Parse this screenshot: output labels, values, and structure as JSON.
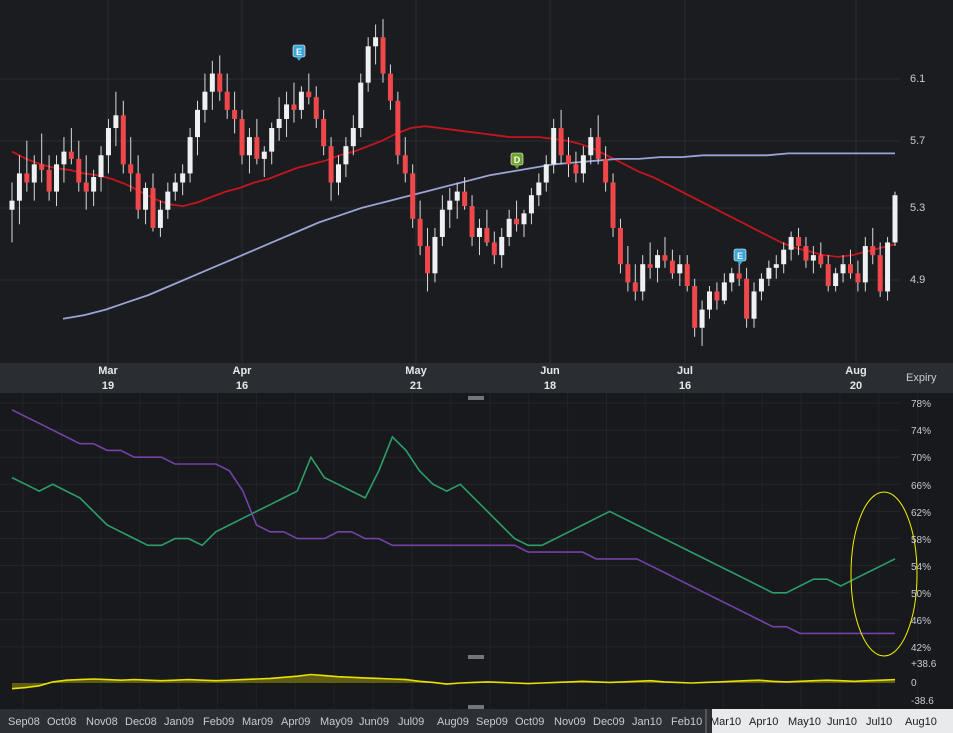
{
  "colors": {
    "background": "#16181b",
    "panel_bg": "#1b1d20",
    "grid": "#2a2d31",
    "candle_up": "#eef0f2",
    "candle_down": "#f0474b",
    "ma_short": "#c5161d",
    "ma_long": "#9aa4d6",
    "hv": "#2e9e68",
    "iv": "#7442a8",
    "spread": "#e8e000",
    "highlight_ellipse": "#f5f000",
    "marker_earnings": "#3aa7d8",
    "marker_dividend": "#6ea12a"
  },
  "price_panel": {
    "y_ticks": [
      "6.1",
      "5.7",
      "5.3",
      "4.9"
    ],
    "month_labels": [
      "Mar",
      "Apr",
      "May",
      "Jun",
      "Jul",
      "Aug"
    ],
    "expiry_days": [
      "19",
      "16",
      "21",
      "18",
      "16",
      "20"
    ],
    "expiry_label": "Expiry",
    "markers": [
      {
        "label": "E",
        "kind": "earnings",
        "date": "Apr 2009"
      },
      {
        "label": "D",
        "kind": "dividend",
        "date": "Jun 2009"
      },
      {
        "label": "E",
        "kind": "earnings",
        "date": "Jul 2009"
      }
    ]
  },
  "vol_panel": {
    "y_ticks": [
      "78%",
      "74%",
      "70%",
      "66%",
      "62%",
      "58%",
      "54%",
      "50%",
      "46%",
      "42%"
    ]
  },
  "spread_panel": {
    "y_ticks": [
      "+38.6",
      "0",
      "-38.6"
    ]
  },
  "x_axis": {
    "labels": [
      "Sep08",
      "Oct08",
      "Nov08",
      "Dec08",
      "Jan09",
      "Feb09",
      "Mar09",
      "Apr09",
      "May09",
      "Jun09",
      "Jul09",
      "Aug09",
      "Sep09",
      "Oct09",
      "Nov09",
      "Dec09",
      "Jan10",
      "Feb10",
      "Mar10",
      "Apr10",
      "May10",
      "Jun10",
      "Jul10",
      "Aug10"
    ],
    "selection_start": "Mar10"
  },
  "chart_data": [
    {
      "type": "candlestick",
      "y_range": [
        4.5,
        6.4
      ],
      "x_range": [
        "Feb 2010",
        "Aug 2010"
      ],
      "candles": [
        [
          5.3,
          5.45,
          5.12,
          5.35
        ],
        [
          5.35,
          5.6,
          5.22,
          5.5
        ],
        [
          5.5,
          5.68,
          5.4,
          5.45
        ],
        [
          5.45,
          5.6,
          5.35,
          5.55
        ],
        [
          5.55,
          5.72,
          5.45,
          5.52
        ],
        [
          5.52,
          5.6,
          5.35,
          5.4
        ],
        [
          5.4,
          5.6,
          5.32,
          5.55
        ],
        [
          5.55,
          5.7,
          5.45,
          5.62
        ],
        [
          5.62,
          5.75,
          5.55,
          5.58
        ],
        [
          5.58,
          5.68,
          5.4,
          5.45
        ],
        [
          5.45,
          5.6,
          5.3,
          5.4
        ],
        [
          5.4,
          5.52,
          5.32,
          5.48
        ],
        [
          5.48,
          5.65,
          5.4,
          5.6
        ],
        [
          5.6,
          5.8,
          5.5,
          5.75
        ],
        [
          5.75,
          5.95,
          5.65,
          5.82
        ],
        [
          5.82,
          5.9,
          5.5,
          5.55
        ],
        [
          5.55,
          5.7,
          5.4,
          5.5
        ],
        [
          5.5,
          5.6,
          5.25,
          5.3
        ],
        [
          5.3,
          5.45,
          5.22,
          5.42
        ],
        [
          5.42,
          5.5,
          5.18,
          5.2
        ],
        [
          5.2,
          5.35,
          5.15,
          5.3
        ],
        [
          5.3,
          5.45,
          5.25,
          5.4
        ],
        [
          5.4,
          5.5,
          5.35,
          5.45
        ],
        [
          5.45,
          5.55,
          5.38,
          5.5
        ],
        [
          5.5,
          5.75,
          5.45,
          5.7
        ],
        [
          5.7,
          5.9,
          5.6,
          5.85
        ],
        [
          5.85,
          6.05,
          5.78,
          5.95
        ],
        [
          5.95,
          6.12,
          5.85,
          6.05
        ],
        [
          6.05,
          6.15,
          5.9,
          5.95
        ],
        [
          5.95,
          6.05,
          5.8,
          5.85
        ],
        [
          5.85,
          5.95,
          5.72,
          5.8
        ],
        [
          5.8,
          5.85,
          5.55,
          5.6
        ],
        [
          5.6,
          5.75,
          5.5,
          5.7
        ],
        [
          5.7,
          5.8,
          5.55,
          5.58
        ],
        [
          5.58,
          5.65,
          5.48,
          5.62
        ],
        [
          5.62,
          5.78,
          5.55,
          5.75
        ],
        [
          5.75,
          5.92,
          5.68,
          5.8
        ],
        [
          5.8,
          5.95,
          5.7,
          5.88
        ],
        [
          5.88,
          6.0,
          5.78,
          5.85
        ],
        [
          5.85,
          5.98,
          5.8,
          5.95
        ],
        [
          5.95,
          6.05,
          5.88,
          5.92
        ],
        [
          5.92,
          5.98,
          5.75,
          5.8
        ],
        [
          5.8,
          5.85,
          5.6,
          5.65
        ],
        [
          5.65,
          5.7,
          5.35,
          5.45
        ],
        [
          5.45,
          5.6,
          5.38,
          5.55
        ],
        [
          5.55,
          5.7,
          5.48,
          5.65
        ],
        [
          5.65,
          5.82,
          5.6,
          5.75
        ],
        [
          5.75,
          6.05,
          5.7,
          6.0
        ],
        [
          6.0,
          6.25,
          5.95,
          6.2
        ],
        [
          6.2,
          6.32,
          6.1,
          6.25
        ],
        [
          6.25,
          6.35,
          6.0,
          6.05
        ],
        [
          6.05,
          6.1,
          5.85,
          5.9
        ],
        [
          5.9,
          5.95,
          5.55,
          5.6
        ],
        [
          5.6,
          5.7,
          5.45,
          5.5
        ],
        [
          5.5,
          5.55,
          5.2,
          5.25
        ],
        [
          5.25,
          5.35,
          5.05,
          5.1
        ],
        [
          5.1,
          5.2,
          4.85,
          4.95
        ],
        [
          4.95,
          5.2,
          4.9,
          5.15
        ],
        [
          5.15,
          5.38,
          5.1,
          5.3
        ],
        [
          5.3,
          5.42,
          5.2,
          5.35
        ],
        [
          5.35,
          5.45,
          5.25,
          5.4
        ],
        [
          5.4,
          5.48,
          5.3,
          5.32
        ],
        [
          5.32,
          5.38,
          5.1,
          5.15
        ],
        [
          5.15,
          5.25,
          5.05,
          5.2
        ],
        [
          5.2,
          5.3,
          5.1,
          5.12
        ],
        [
          5.12,
          5.18,
          5.0,
          5.05
        ],
        [
          5.05,
          5.2,
          4.98,
          5.15
        ],
        [
          5.15,
          5.3,
          5.1,
          5.25
        ],
        [
          5.25,
          5.35,
          5.18,
          5.22
        ],
        [
          5.22,
          5.3,
          5.15,
          5.28
        ],
        [
          5.28,
          5.42,
          5.22,
          5.38
        ],
        [
          5.38,
          5.5,
          5.32,
          5.45
        ],
        [
          5.45,
          5.6,
          5.4,
          5.55
        ],
        [
          5.55,
          5.8,
          5.5,
          5.75
        ],
        [
          5.75,
          5.85,
          5.55,
          5.6
        ],
        [
          5.6,
          5.7,
          5.48,
          5.55
        ],
        [
          5.55,
          5.62,
          5.45,
          5.5
        ],
        [
          5.5,
          5.65,
          5.45,
          5.6
        ],
        [
          5.6,
          5.75,
          5.55,
          5.7
        ],
        [
          5.7,
          5.82,
          5.55,
          5.58
        ],
        [
          5.58,
          5.65,
          5.4,
          5.45
        ],
        [
          5.45,
          5.5,
          5.15,
          5.2
        ],
        [
          5.2,
          5.25,
          4.95,
          5.0
        ],
        [
          5.0,
          5.1,
          4.85,
          4.9
        ],
        [
          4.9,
          5.0,
          4.8,
          4.85
        ],
        [
          4.85,
          5.05,
          4.8,
          5.0
        ],
        [
          5.0,
          5.12,
          4.92,
          4.98
        ],
        [
          4.98,
          5.08,
          4.9,
          5.05
        ],
        [
          5.05,
          5.15,
          4.98,
          5.02
        ],
        [
          5.02,
          5.08,
          4.92,
          4.95
        ],
        [
          4.95,
          5.05,
          4.88,
          5.0
        ],
        [
          5.0,
          5.05,
          4.85,
          4.88
        ],
        [
          4.88,
          4.92,
          4.6,
          4.65
        ],
        [
          4.65,
          4.8,
          4.55,
          4.75
        ],
        [
          4.75,
          4.88,
          4.7,
          4.85
        ],
        [
          4.85,
          4.9,
          4.75,
          4.8
        ],
        [
          4.8,
          4.95,
          4.78,
          4.9
        ],
        [
          4.9,
          4.98,
          4.85,
          4.95
        ],
        [
          4.95,
          5.02,
          4.88,
          4.92
        ],
        [
          4.92,
          4.98,
          4.65,
          4.7
        ],
        [
          4.7,
          4.9,
          4.65,
          4.85
        ],
        [
          4.85,
          4.95,
          4.8,
          4.92
        ],
        [
          4.92,
          5.02,
          4.88,
          4.98
        ],
        [
          4.98,
          5.05,
          4.92,
          5.0
        ],
        [
          5.0,
          5.12,
          4.95,
          5.08
        ],
        [
          5.08,
          5.18,
          5.02,
          5.15
        ],
        [
          5.15,
          5.2,
          5.05,
          5.1
        ],
        [
          5.1,
          5.15,
          4.98,
          5.02
        ],
        [
          5.02,
          5.1,
          4.95,
          5.05
        ],
        [
          5.05,
          5.12,
          4.98,
          5.0
        ],
        [
          5.0,
          5.05,
          4.85,
          4.88
        ],
        [
          4.88,
          4.98,
          4.85,
          4.95
        ],
        [
          4.95,
          5.05,
          4.9,
          5.0
        ],
        [
          5.0,
          5.08,
          4.92,
          4.95
        ],
        [
          4.95,
          5.02,
          4.85,
          4.9
        ],
        [
          4.9,
          5.15,
          4.85,
          5.1
        ],
        [
          5.1,
          5.2,
          5.0,
          5.05
        ],
        [
          5.05,
          5.12,
          4.82,
          4.85
        ],
        [
          4.85,
          5.15,
          4.8,
          5.12
        ],
        [
          5.12,
          5.4,
          5.1,
          5.38
        ]
      ],
      "ma_short": [
        5.62,
        5.58,
        5.55,
        5.53,
        5.52,
        5.5,
        5.49,
        5.47,
        5.44,
        5.4,
        5.36,
        5.33,
        5.32,
        5.34,
        5.37,
        5.4,
        5.42,
        5.45,
        5.47,
        5.5,
        5.53,
        5.55,
        5.57,
        5.6,
        5.62,
        5.65,
        5.68,
        5.72,
        5.75,
        5.76,
        5.75,
        5.74,
        5.73,
        5.72,
        5.71,
        5.7,
        5.7,
        5.7,
        5.69,
        5.68,
        5.66,
        5.63,
        5.59,
        5.55,
        5.51,
        5.48,
        5.44,
        5.4,
        5.36,
        5.32,
        5.28,
        5.24,
        5.2,
        5.16,
        5.12,
        5.09,
        5.07,
        5.05,
        5.04,
        5.05,
        5.07,
        5.09,
        5.11
      ],
      "ma_long": [
        4.7,
        4.72,
        4.75,
        4.79,
        4.83,
        4.88,
        4.93,
        4.98,
        5.03,
        5.08,
        5.13,
        5.18,
        5.23,
        5.27,
        5.31,
        5.34,
        5.37,
        5.4,
        5.43,
        5.46,
        5.49,
        5.51,
        5.53,
        5.55,
        5.56,
        5.57,
        5.58,
        5.58,
        5.59,
        5.59,
        5.6,
        5.6,
        5.6,
        5.6,
        5.61,
        5.61,
        5.61,
        5.61,
        5.61,
        5.61
      ]
    },
    {
      "type": "line",
      "title": "",
      "y_range": [
        40,
        80
      ],
      "x_range": [
        "Sep 2008",
        "Aug 2010"
      ],
      "series": [
        {
          "values": [
            67,
            66,
            65,
            66,
            65,
            64,
            62,
            60,
            59,
            58,
            57,
            57,
            58,
            58,
            57,
            59,
            60,
            61,
            62,
            63,
            64,
            65,
            70,
            67,
            66,
            65,
            64,
            68,
            73,
            71,
            68,
            66,
            65,
            66,
            64,
            62,
            60,
            58,
            57,
            57,
            58,
            59,
            60,
            61,
            62,
            61,
            60,
            59,
            58,
            57,
            56,
            55,
            54,
            53,
            52,
            51,
            50,
            50,
            51,
            52,
            52,
            51,
            52,
            53,
            54,
            55
          ]
        },
        {
          "values": [
            77,
            76,
            75,
            74,
            73,
            72,
            72,
            71,
            71,
            70,
            70,
            70,
            69,
            69,
            69,
            69,
            68,
            65,
            60,
            59,
            59,
            58,
            58,
            58,
            59,
            59,
            58,
            58,
            57,
            57,
            57,
            57,
            57,
            57,
            57,
            57,
            57,
            57,
            56,
            56,
            56,
            56,
            56,
            55,
            55,
            55,
            55,
            54,
            53,
            52,
            51,
            50,
            49,
            48,
            47,
            46,
            45,
            45,
            44,
            44,
            44,
            44,
            44,
            44,
            44,
            44
          ]
        }
      ]
    },
    {
      "type": "area",
      "y_range": [
        -38.6,
        38.6
      ],
      "x_range": [
        "Sep 2008",
        "Aug 2010"
      ],
      "values": [
        -10,
        -8,
        -5,
        2,
        5,
        6,
        7,
        6,
        5,
        6,
        5,
        4,
        5,
        6,
        5,
        4,
        5,
        6,
        7,
        8,
        10,
        12,
        15,
        13,
        11,
        10,
        9,
        8,
        7,
        6,
        3,
        1,
        -2,
        0,
        1,
        2,
        1,
        0,
        -1,
        0,
        1,
        2,
        3,
        2,
        1,
        2,
        3,
        4,
        2,
        1,
        0,
        1,
        2,
        3,
        4,
        5,
        3,
        2,
        3,
        4,
        5,
        4,
        3,
        4,
        5,
        6
      ]
    }
  ]
}
